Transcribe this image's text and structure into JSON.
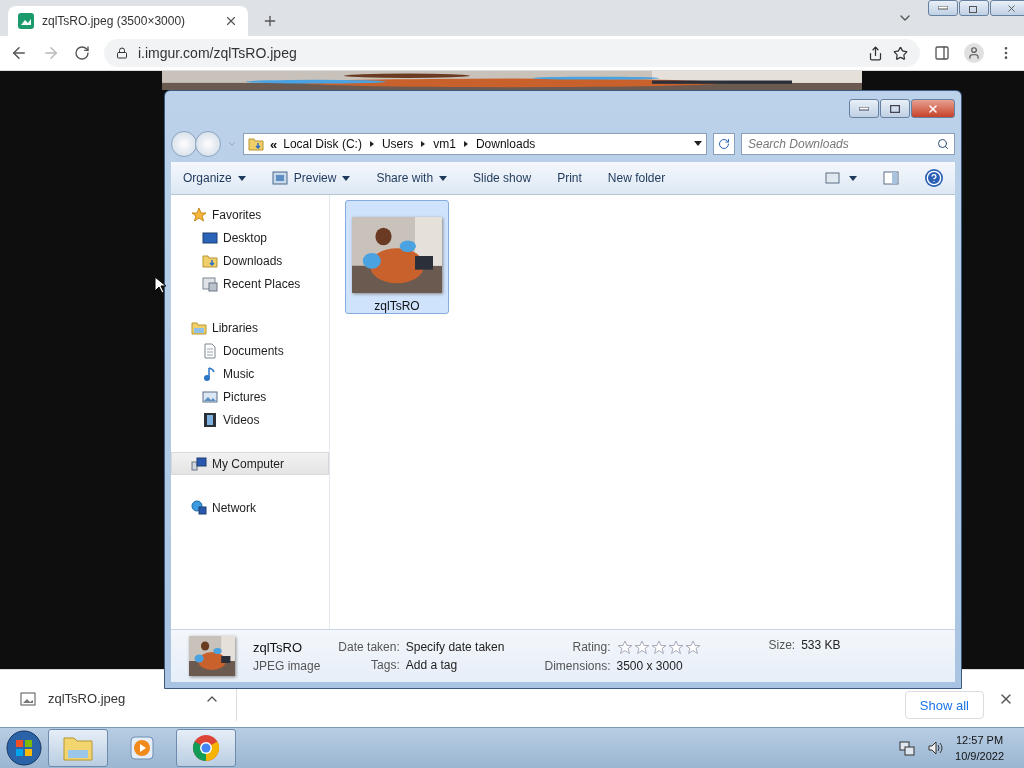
{
  "browser": {
    "tab": {
      "title": "zqlTsRO.jpeg (3500×3000)"
    },
    "address": "i.imgur.com/zqlTsRO.jpeg"
  },
  "explorer": {
    "breadcrumb_overflow": "«",
    "breadcrumb": [
      "Local Disk (C:)",
      "Users",
      "vm1",
      "Downloads"
    ],
    "search": {
      "placeholder": "Search Downloads"
    },
    "toolbar": [
      {
        "label": "Organize",
        "dropdown": true,
        "kind": "text"
      },
      {
        "label": "Preview",
        "dropdown": true,
        "kind": "preview"
      },
      {
        "label": "Share with",
        "dropdown": true,
        "kind": "text"
      },
      {
        "label": "Slide show",
        "dropdown": false,
        "kind": "text"
      },
      {
        "label": "Print",
        "dropdown": false,
        "kind": "text"
      },
      {
        "label": "New folder",
        "dropdown": false,
        "kind": "text"
      }
    ],
    "nav": [
      {
        "label": "Favorites",
        "kind": "favorites",
        "selected": false,
        "children": [
          {
            "label": "Desktop",
            "kind": "desktop",
            "selected": false
          },
          {
            "label": "Downloads",
            "kind": "downloads",
            "selected": false
          },
          {
            "label": "Recent Places",
            "kind": "recent",
            "selected": false
          }
        ]
      },
      {
        "label": "Libraries",
        "kind": "libraries",
        "selected": false,
        "children": [
          {
            "label": "Documents",
            "kind": "documents",
            "selected": false
          },
          {
            "label": "Music",
            "kind": "music",
            "selected": false
          },
          {
            "label": "Pictures",
            "kind": "pictures",
            "selected": false
          },
          {
            "label": "Videos",
            "kind": "videos",
            "selected": false
          }
        ]
      },
      {
        "label": "My Computer",
        "kind": "computer",
        "selected": true
      },
      {
        "label": "Network",
        "kind": "network",
        "selected": false
      }
    ],
    "files": [
      {
        "name": "zqlTsRO",
        "selected": true
      }
    ],
    "details": {
      "name": "zqlTsRO",
      "type": "JPEG image",
      "date_label": "Date taken:",
      "date_value": "Specify date taken",
      "tags_label": "Tags:",
      "tags_value": "Add a tag",
      "rating_label": "Rating:",
      "stars": 0,
      "dimensions_label": "Dimensions:",
      "dimensions_value": "3500 x 3000",
      "size_label": "Size:",
      "size_value": "533 KB"
    }
  },
  "downloads": {
    "file": "zqlTsRO.jpeg",
    "show_all": "Show all"
  },
  "taskbar": {
    "apps": [
      {
        "kind": "explorer",
        "selected": true
      },
      {
        "kind": "media",
        "selected": false
      },
      {
        "kind": "chrome",
        "selected": true
      }
    ],
    "time": "12:57 PM",
    "date": "10/9/2022"
  }
}
